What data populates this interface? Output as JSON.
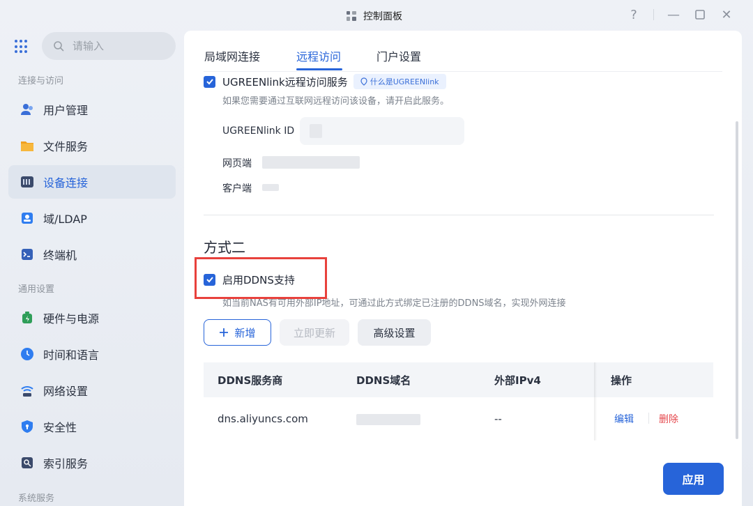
{
  "window": {
    "title": "控制面板",
    "controls": {
      "help": "?",
      "minimize": "—",
      "maximize": "☐",
      "close": "✕"
    }
  },
  "sidebar": {
    "search_placeholder": "请输入",
    "section1": "连接与访问",
    "section2": "通用设置",
    "section3": "系统服务",
    "items": [
      {
        "label": "用户管理",
        "icon": "users-icon",
        "color": "#3a6fd8"
      },
      {
        "label": "文件服务",
        "icon": "folder-icon",
        "color": "#f0a020"
      },
      {
        "label": "设备连接",
        "icon": "device-icon",
        "color": "#3b4a6b"
      },
      {
        "label": "域/LDAP",
        "icon": "ldap-icon",
        "color": "#2f7df0"
      },
      {
        "label": "终端机",
        "icon": "terminal-icon",
        "color": "#3561b8"
      },
      {
        "label": "硬件与电源",
        "icon": "battery-icon",
        "color": "#2f9e59"
      },
      {
        "label": "时间和语言",
        "icon": "clock-icon",
        "color": "#2f7df0"
      },
      {
        "label": "网络设置",
        "icon": "network-icon",
        "color": "#2f7df0"
      },
      {
        "label": "安全性",
        "icon": "shield-icon",
        "color": "#2f7df0"
      },
      {
        "label": "索引服务",
        "icon": "index-icon",
        "color": "#3b4a6b"
      }
    ]
  },
  "tabs": [
    "局域网连接",
    "远程访问",
    "门户设置"
  ],
  "method1": {
    "checkbox_label": "UGREENlink远程访问服务",
    "help_chip": "什么是UGREENlink",
    "description": "如果您需要通过互联网远程访问该设备，请开启此服务。",
    "id_label": "UGREENlink ID",
    "web_label": "网页端",
    "client_label": "客户端"
  },
  "method2": {
    "title": "方式二",
    "checkbox_label": "启用DDNS支持",
    "description": "如当前NAS有可用外部IP地址，可通过此方式绑定已注册的DDNS域名，实现外网连接"
  },
  "buttons": {
    "add": "新增",
    "refresh": "立即更新",
    "advanced": "高级设置",
    "apply": "应用"
  },
  "table": {
    "headers": [
      "DDNS服务商",
      "DDNS域名",
      "外部IPv4",
      "操作"
    ],
    "rows": [
      {
        "provider": "dns.aliyuncs.com",
        "ipv4": "--",
        "edit": "编辑",
        "delete": "删除"
      }
    ]
  },
  "colors": {
    "accent": "#2764d9",
    "danger": "#e5484d",
    "highlight": "#e8413c"
  }
}
